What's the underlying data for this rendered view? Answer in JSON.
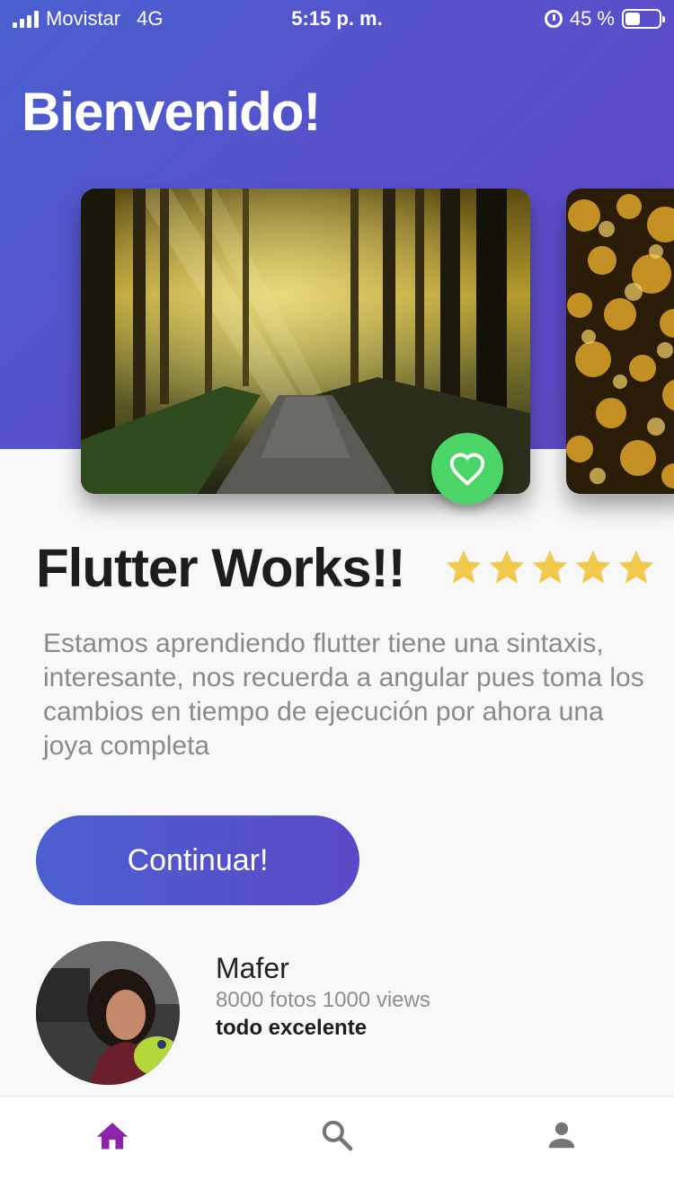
{
  "status_bar": {
    "carrier": "Movistar",
    "network": "4G",
    "time": "5:15 p. m.",
    "battery_text": "45 %",
    "battery_level": 0.45
  },
  "header": {
    "title": "Bienvenido!"
  },
  "cards": [
    {
      "icon": "forest-photo"
    },
    {
      "icon": "bokeh-photo"
    }
  ],
  "favorite": {
    "icon": "heart-icon",
    "color": "#4cd567"
  },
  "place": {
    "title": "Flutter Works!!",
    "rating": 5,
    "rating_max": 5,
    "description": "Estamos aprendiendo flutter tiene una sintaxis, interesante, nos recuerda a angular pues toma los cambios en tiempo de ejecución  por ahora una joya completa"
  },
  "actions": {
    "continue_label": "Continuar!"
  },
  "user": {
    "name": "Mafer",
    "stats": "8000 fotos 1000 views",
    "status": "todo excelente"
  },
  "bottom_nav": {
    "items": [
      {
        "icon": "home-icon",
        "active": true
      },
      {
        "icon": "search-icon",
        "active": false
      },
      {
        "icon": "person-icon",
        "active": false
      }
    ],
    "active_color": "#8e24aa",
    "inactive_color": "#757575"
  },
  "colors": {
    "header_gradient_start": "#4a5fd0",
    "header_gradient_end": "#6248c6",
    "star_color": "#f2c94c",
    "button_gradient_start": "#4b5fd0",
    "button_gradient_end": "#5a4ac8"
  }
}
